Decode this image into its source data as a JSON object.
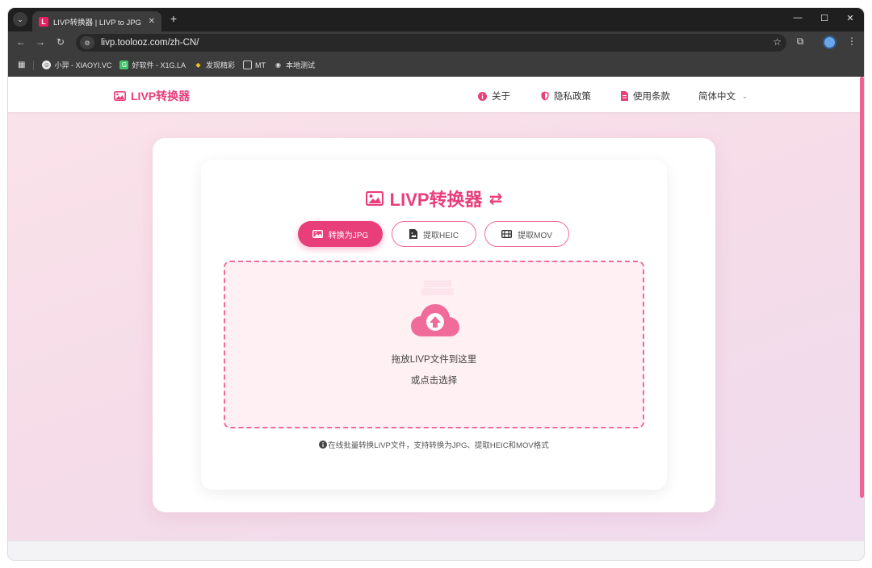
{
  "browser": {
    "tab_title": "LIVP转换器 | LIVP to JPG - 在线",
    "tab_favicon_letter": "L",
    "url": "livp.toolooz.com/zh-CN/",
    "bookmarks": [
      {
        "label": "小羿 - XIAOYI.VC",
        "icon": "avatar-icon"
      },
      {
        "label": "好软件 - X1G.LA",
        "icon": "app-icon"
      },
      {
        "label": "发现精彩",
        "icon": "sparkle-icon"
      },
      {
        "label": "MT",
        "icon": "folder-icon"
      },
      {
        "label": "本地测试",
        "icon": "globe-icon"
      }
    ]
  },
  "header": {
    "logo_text": "LIVP转换器",
    "nav": [
      {
        "label": "关于",
        "icon": "info-icon"
      },
      {
        "label": "隐私政策",
        "icon": "shield-icon"
      },
      {
        "label": "使用条款",
        "icon": "document-icon"
      }
    ],
    "language": "简体中文"
  },
  "main": {
    "title": "LIVP转换器",
    "tabs": [
      {
        "label": "转换为JPG",
        "icon": "image-icon",
        "active": true
      },
      {
        "label": "提取HEIC",
        "icon": "file-image-icon",
        "active": false
      },
      {
        "label": "提取MOV",
        "icon": "film-icon",
        "active": false
      }
    ],
    "dropzone": {
      "primary": "拖放LIVP文件到这里",
      "secondary": "或点击选择"
    },
    "info": "在线批量转换LIVP文件，支持转换为JPG、提取HEIC和MOV格式"
  },
  "colors": {
    "accent": "#e83e7a",
    "accent_light": "#f06b9a",
    "dropzone_bg": "#fff0f4"
  }
}
